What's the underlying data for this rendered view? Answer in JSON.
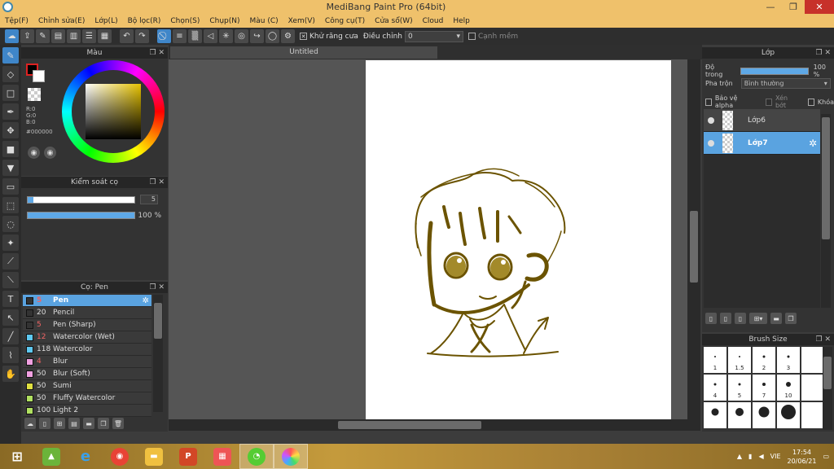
{
  "window": {
    "title": "MediBang Paint Pro (64bit)"
  },
  "menu": [
    "Tệp(F)",
    "Chỉnh sửa(E)",
    "Lớp(L)",
    "Bộ lọc(R)",
    "Chọn(S)",
    "Chụp(N)",
    "Màu (C)",
    "Xem(V)",
    "Công cụ(T)",
    "Cửa sổ(W)",
    "Cloud",
    "Help"
  ],
  "toolbar": {
    "antialias_label": "Khử răng cưa",
    "adjust_label": "Điều chỉnh",
    "adjust_value": "0",
    "edge_label": "Cạnh mềm"
  },
  "color_panel": {
    "title": "Màu",
    "r": "R:0",
    "g": "G:0",
    "b": "B:0",
    "hex": "#000000",
    "fg_color": "#000000",
    "bg_color": "#ffffff"
  },
  "brush_control": {
    "title": "Kiểm soát cọ",
    "size_value": "5",
    "size_fraction": 0.05,
    "opacity_label": "100 %",
    "opacity_fraction": 1.0
  },
  "pen_panel": {
    "title": "Cọ: Pen",
    "brushes": [
      {
        "size": "5",
        "name": "Pen",
        "color": "#333333",
        "selected": true
      },
      {
        "size": "20",
        "name": "Pencil",
        "color": "#333333"
      },
      {
        "size": "5",
        "name": "Pen (Sharp)",
        "color": "#333333"
      },
      {
        "size": "12",
        "name": "Watercolor (Wet)",
        "color": "#5ec8f0"
      },
      {
        "size": "118",
        "name": "Watercolor",
        "color": "#5ec8f0"
      },
      {
        "size": "4",
        "name": "Blur",
        "color": "#f0a0e0"
      },
      {
        "size": "50",
        "name": "Blur (Soft)",
        "color": "#f0a0e0"
      },
      {
        "size": "50",
        "name": "Sumi",
        "color": "#e0e040"
      },
      {
        "size": "50",
        "name": "Fluffy Watercolor",
        "color": "#b0e060"
      },
      {
        "size": "100",
        "name": "Light 2",
        "color": "#b0e060"
      }
    ]
  },
  "document": {
    "tab": "Untitled"
  },
  "layer_panel": {
    "title": "Lớp",
    "opacity_label": "Độ trong",
    "opacity_value": "100 %",
    "blend_label": "Pha trộn",
    "blend_value": "Bình thường",
    "protect_alpha": "Bảo vệ alpha",
    "clip": "Xén bớt",
    "lock": "Khóa",
    "layers": [
      {
        "name": "Lớp6",
        "selected": false
      },
      {
        "name": "Lớp7",
        "selected": true
      }
    ]
  },
  "brush_size_panel": {
    "title": "Brush Size",
    "sizes": [
      "1",
      "1.5",
      "2",
      "3",
      "",
      "4",
      "5",
      "7",
      "10",
      "",
      "",
      "",
      "",
      "",
      ""
    ]
  },
  "taskbar": {
    "language": "VIE",
    "time": "17:54",
    "date": "20/06/21"
  },
  "drawing": {
    "stroke_color": "#6b5300",
    "fill_color": "#a38a2a"
  }
}
